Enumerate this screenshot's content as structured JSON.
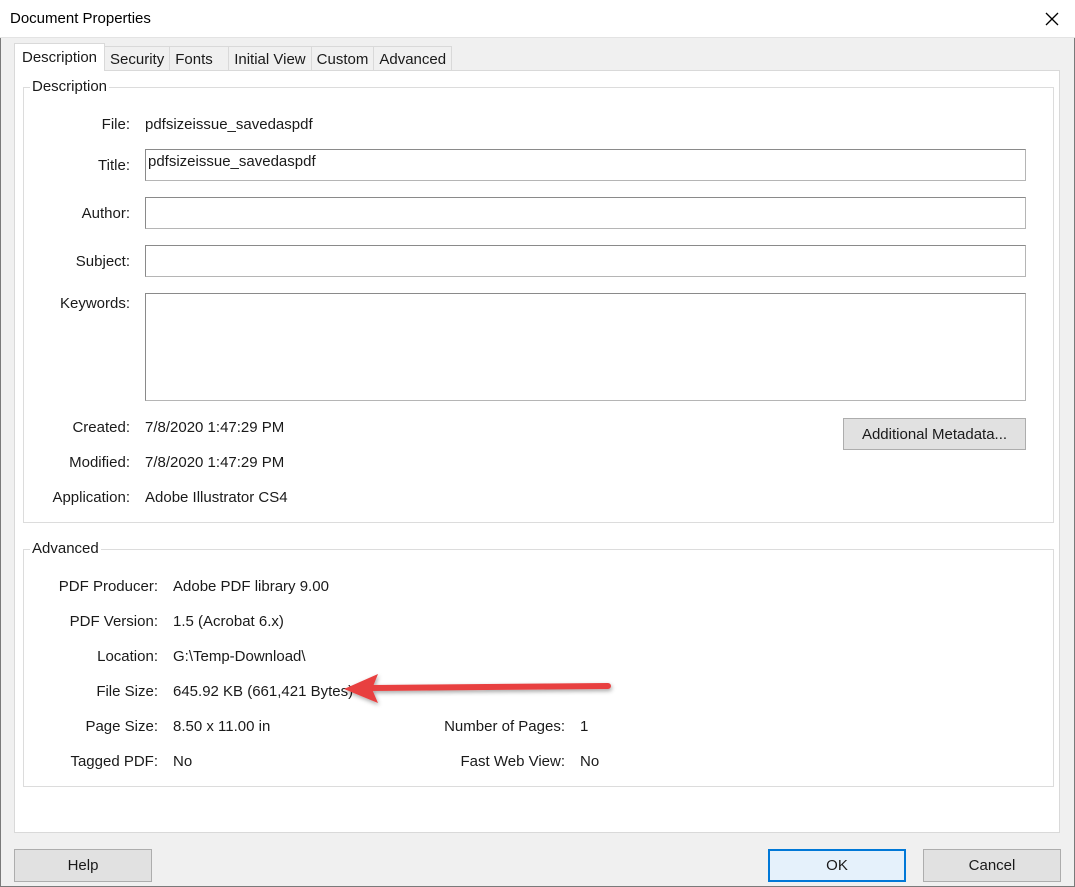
{
  "window": {
    "title": "Document Properties"
  },
  "tabs": [
    {
      "label": "Description",
      "active": true
    },
    {
      "label": "Security"
    },
    {
      "label": "Fonts"
    },
    {
      "label": "Initial View"
    },
    {
      "label": "Custom"
    },
    {
      "label": "Advanced"
    }
  ],
  "description": {
    "group_label": "Description",
    "file_label": "File:",
    "file_value": "pdfsizeissue_savedaspdf",
    "title_label": "Title:",
    "title_value": "pdfsizeissue_savedaspdf",
    "author_label": "Author:",
    "author_value": "",
    "subject_label": "Subject:",
    "subject_value": "",
    "keywords_label": "Keywords:",
    "keywords_value": "",
    "created_label": "Created:",
    "created_value": "7/8/2020 1:47:29 PM",
    "modified_label": "Modified:",
    "modified_value": "7/8/2020 1:47:29 PM",
    "application_label": "Application:",
    "application_value": "Adobe Illustrator CS4",
    "metadata_button": "Additional Metadata..."
  },
  "advanced": {
    "group_label": "Advanced",
    "producer_label": "PDF Producer:",
    "producer_value": "Adobe PDF library 9.00",
    "version_label": "PDF Version:",
    "version_value": "1.5 (Acrobat 6.x)",
    "location_label": "Location:",
    "location_value": "G:\\Temp-Download\\",
    "filesize_label": "File Size:",
    "filesize_value": "645.92 KB (661,421 Bytes)",
    "pagesize_label": "Page Size:",
    "pagesize_value": "8.50 x 11.00 in",
    "numpages_label": "Number of Pages:",
    "numpages_value": "1",
    "tagged_label": "Tagged PDF:",
    "tagged_value": "No",
    "fastweb_label": "Fast Web View:",
    "fastweb_value": "No"
  },
  "footer": {
    "help": "Help",
    "ok": "OK",
    "cancel": "Cancel"
  },
  "colors": {
    "accent": "#0078d7",
    "annotation_arrow": "#e8403f"
  }
}
